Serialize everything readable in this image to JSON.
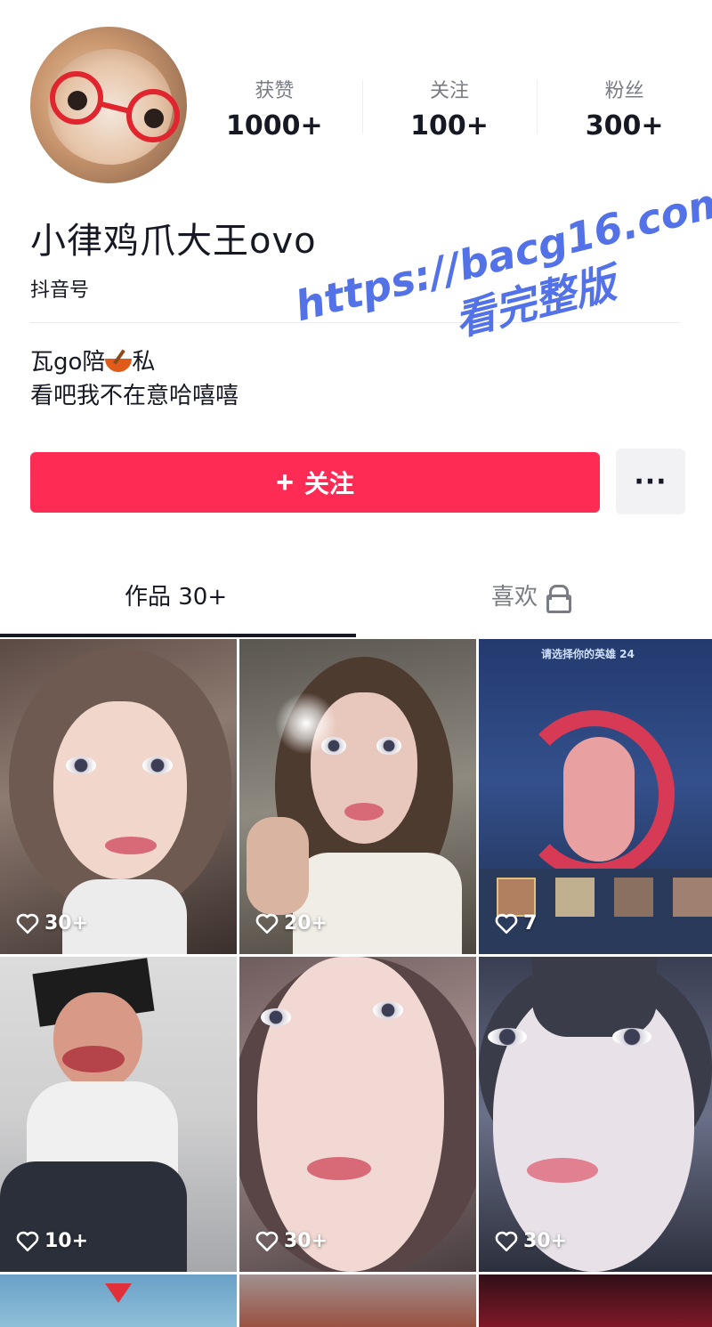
{
  "profile": {
    "nickname": "小律鸡爪大王ovo",
    "douyin_id_label": "抖音号",
    "bio_line1_prefix": "瓦go陪",
    "bio_line1_suffix": "私",
    "bio_line2": "看吧我不在意哈嘻嘻"
  },
  "stats": [
    {
      "label": "获赞",
      "value": "1000+"
    },
    {
      "label": "关注",
      "value": "100+"
    },
    {
      "label": "粉丝",
      "value": "300+"
    }
  ],
  "actions": {
    "follow_plus": "+",
    "follow_label": "关注",
    "more_label": "···"
  },
  "tabs": {
    "works_label": "作品 30+",
    "likes_label": "喜欢"
  },
  "posts": [
    {
      "likes": "30+"
    },
    {
      "likes": "20+"
    },
    {
      "likes": "7"
    },
    {
      "likes": "10+"
    },
    {
      "likes": "30+"
    },
    {
      "likes": "30+"
    }
  ],
  "game_banner": "请选择你的英雄 24",
  "watermark": {
    "url": "https://bacg16.com",
    "text": "看完整版"
  },
  "colors": {
    "accent": "#fe2c55",
    "text_primary": "#161823",
    "text_secondary": "#7a7c85",
    "watermark": "#5472e8"
  }
}
